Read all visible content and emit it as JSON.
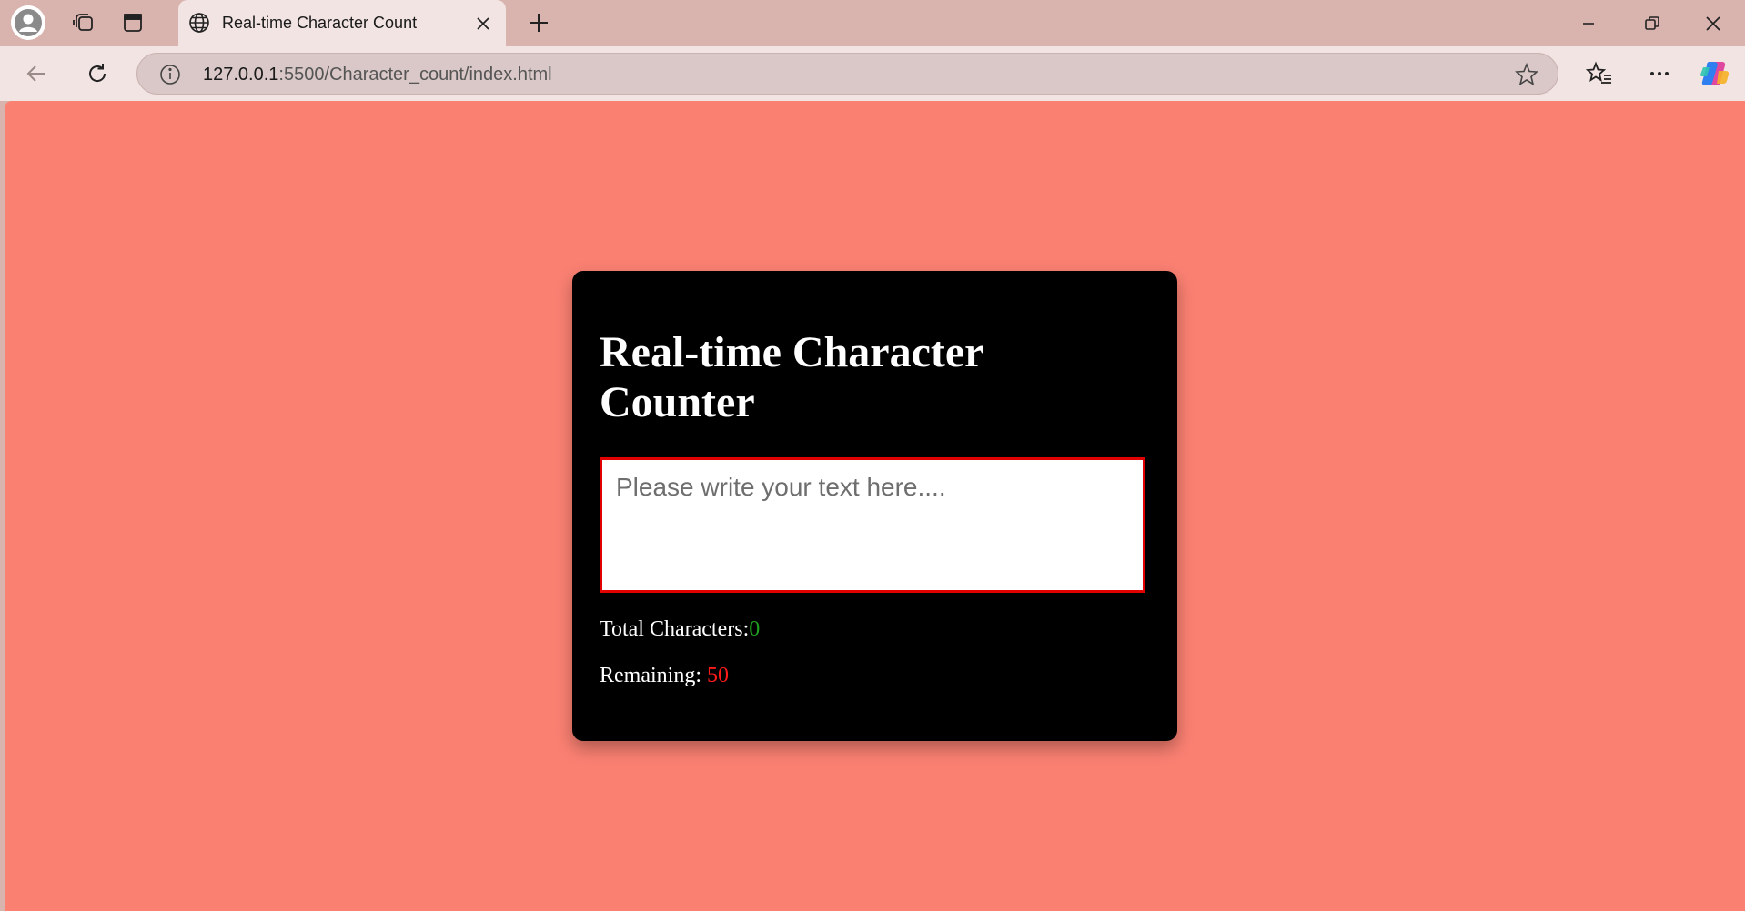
{
  "browser": {
    "tab": {
      "title": "Real-time Character Count"
    },
    "address": {
      "host": "127.0.0.1",
      "path": ":5500/Character_count/index.html"
    }
  },
  "page": {
    "background_color": "#fa8072",
    "card": {
      "title": "Real-time Character Counter",
      "textarea_placeholder": "Please write your text here....",
      "textarea_value": "",
      "total_label": "Total Characters:",
      "total_value": "0",
      "remaining_label": "Remaining: ",
      "remaining_value": "50",
      "total_value_color": "#1fa11f",
      "remaining_value_color": "#ff1a1a",
      "textarea_border_color": "#e00000"
    }
  },
  "icons": {
    "profile": "profile-icon",
    "workspaces": "workspaces-icon",
    "tab_actions": "tab-actions-icon",
    "globe": "globe-icon",
    "close": "close-icon",
    "new_tab": "plus-icon",
    "minimize": "minimize-icon",
    "restore": "restore-icon",
    "window_close": "window-close-icon",
    "back": "back-arrow-icon",
    "refresh": "refresh-icon",
    "info": "info-icon",
    "favorite": "star-icon",
    "favorites": "favorites-icon",
    "more": "more-icon",
    "copilot": "copilot-icon"
  }
}
